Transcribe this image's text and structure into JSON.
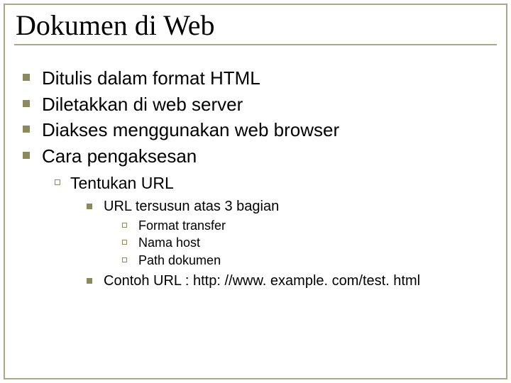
{
  "title": "Dokumen di Web",
  "level1": [
    "Ditulis dalam format HTML",
    "Diletakkan di web server",
    "Diakses menggunakan web browser",
    "Cara pengaksesan"
  ],
  "level2": [
    "Tentukan URL"
  ],
  "level3a": [
    "URL tersusun atas 3 bagian"
  ],
  "level4": [
    "Format transfer",
    "Nama host",
    "Path dokumen"
  ],
  "level3b": [
    "Contoh URL : http: //www. example. com/test. html"
  ]
}
